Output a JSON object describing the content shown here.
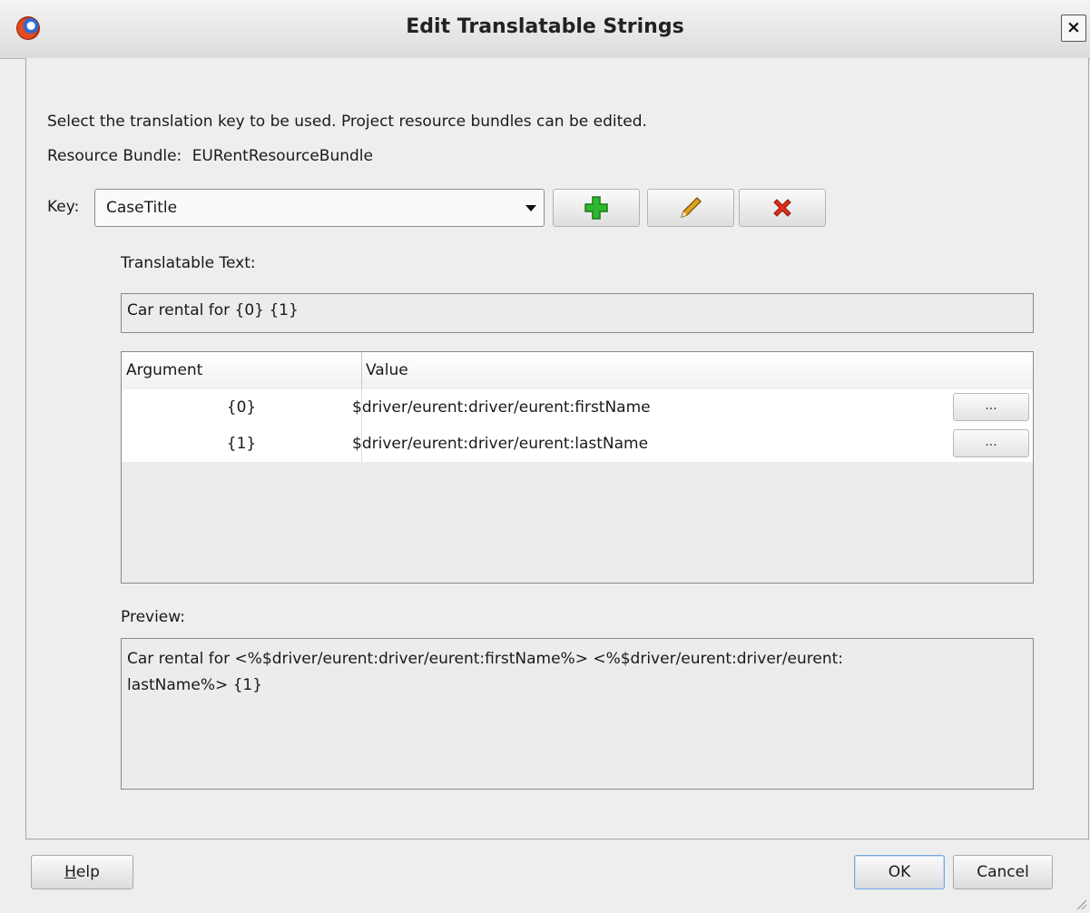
{
  "window": {
    "title": "Edit Translatable Strings",
    "close_label": "×"
  },
  "instructions": "Select the translation key to be used. Project resource bundles can be edited.",
  "resource_bundle": {
    "label": "Resource Bundle:",
    "value": "EURentResourceBundle"
  },
  "key": {
    "label": "Key:",
    "selected": "CaseTitle"
  },
  "toolbar": {
    "add_icon": "plus-icon",
    "edit_icon": "pencil-icon",
    "delete_icon": "delete-icon",
    "colors": {
      "add": "#2fb82f",
      "edit": "#e0a020",
      "delete": "#e0301c"
    }
  },
  "translatable_text": {
    "label": "Translatable Text:",
    "value": "Car rental for {0} {1}"
  },
  "table": {
    "headers": [
      "Argument",
      "Value"
    ],
    "rows": [
      {
        "argument": "{0}",
        "value": "$driver/eurent:driver/eurent:firstName",
        "button": "..."
      },
      {
        "argument": "{1}",
        "value": "$driver/eurent:driver/eurent:lastName",
        "button": "..."
      }
    ]
  },
  "preview": {
    "label": "Preview:",
    "line1": "Car rental for <%$driver/eurent:driver/eurent:firstName%> <%$driver/eurent:driver/eurent:",
    "line2": "lastName%> {1}"
  },
  "buttons": {
    "help_mnemonic": "H",
    "help_rest": "elp",
    "ok": "OK",
    "cancel": "Cancel"
  }
}
